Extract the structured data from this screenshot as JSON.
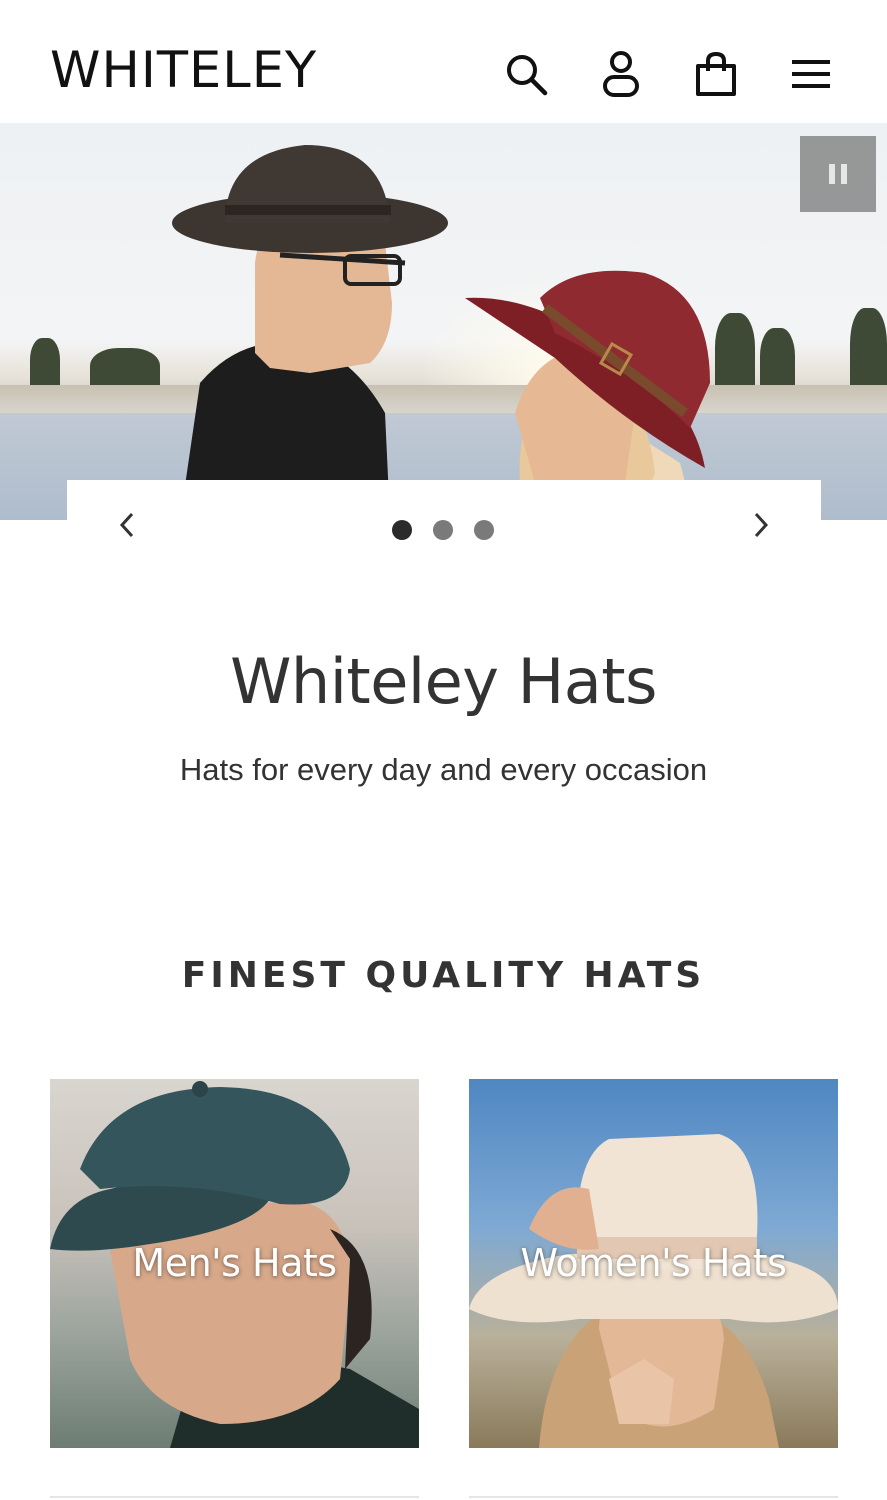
{
  "header": {
    "logo": "WHITELEY",
    "icons": [
      "search-icon",
      "account-icon",
      "cart-icon",
      "menu-icon"
    ]
  },
  "hero": {
    "slide_count": 3,
    "active_slide": 1
  },
  "intro": {
    "title": "Whiteley Hats",
    "subtitle": "Hats for every day and every occasion"
  },
  "collections": {
    "title": "FINEST QUALITY HATS",
    "items": [
      {
        "label": "Men's Hats"
      },
      {
        "label": "Women's Hats"
      }
    ]
  },
  "colors": {
    "text": "#333333",
    "background": "#ffffff",
    "dot_active": "#2b2b2b",
    "dot_inactive": "#7a7a7a"
  }
}
